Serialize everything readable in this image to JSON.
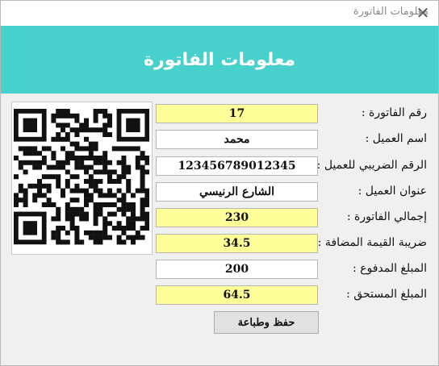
{
  "window": {
    "title": "معلومات الفاتورة",
    "close_icon": "close-icon"
  },
  "header": {
    "title": "معلومات الفاتورة",
    "background_color": "#48d1cc"
  },
  "qr_code": {
    "icon": "qr-code-image"
  },
  "form": {
    "invoice_number": {
      "label": "رقم الفاتورة :",
      "value": "17"
    },
    "customer_name": {
      "label": "اسم العميل :",
      "value": "محمد"
    },
    "customer_tax_number": {
      "label": "الرقم الضريبي للعميل :",
      "value": "123456789012345"
    },
    "customer_address": {
      "label": "عنوان العميل :",
      "value": "الشارع الرنيسي"
    },
    "invoice_total": {
      "label": "إجمالي الفاتورة :",
      "value": "230"
    },
    "vat": {
      "label": "ضريبة القيمة المضافة :",
      "value": "34.5"
    },
    "amount_paid": {
      "label": "المبلغ المدفوع :",
      "value": "200"
    },
    "amount_due": {
      "label": "المبلغ المستحق :",
      "value": "64.5"
    }
  },
  "actions": {
    "save_print_label": "حفظ وطباعة"
  },
  "colors": {
    "readonly_field": "#ffff99",
    "editable_field": "#ffffff"
  }
}
